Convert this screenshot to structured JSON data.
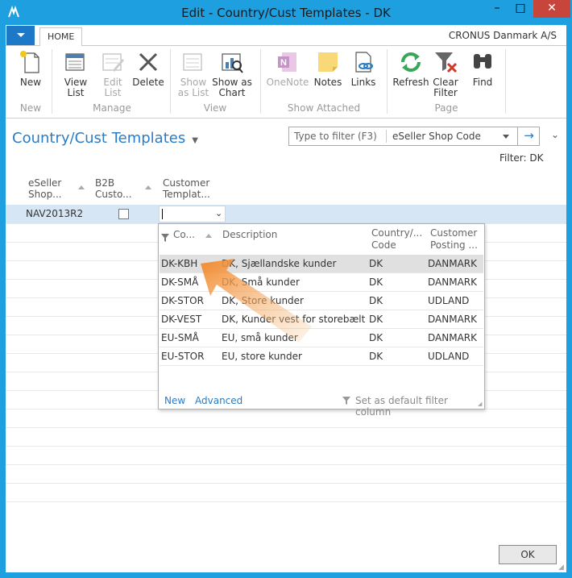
{
  "window": {
    "title": "Edit - Country/Cust Templates - DK",
    "minimize": "–",
    "maximize": "□",
    "close": "✕"
  },
  "ribbon": {
    "tab_home": "HOME",
    "company": "CRONUS Danmark A/S",
    "buttons": {
      "new": "New",
      "view_list_1": "View",
      "view_list_2": "List",
      "edit_list_1": "Edit",
      "edit_list_2": "List",
      "delete": "Delete",
      "show_as_list_1": "Show",
      "show_as_list_2": "as List",
      "show_as_chart_1": "Show as",
      "show_as_chart_2": "Chart",
      "onenote": "OneNote",
      "notes": "Notes",
      "links": "Links",
      "refresh": "Refresh",
      "clear_filter_1": "Clear",
      "clear_filter_2": "Filter",
      "find": "Find"
    },
    "groups": {
      "new": "New",
      "manage": "Manage",
      "view": "View",
      "show_attached": "Show Attached",
      "page": "Page"
    }
  },
  "page": {
    "title": "Country/Cust Templates",
    "filter_placeholder": "Type to filter (F3)",
    "filter_field": "eSeller Shop Code",
    "filter_info": "Filter: DK"
  },
  "grid": {
    "columns": [
      {
        "line1": "eSeller",
        "line2": "Shop..."
      },
      {
        "line1": "B2B",
        "line2": "Custo..."
      },
      {
        "line1": "Customer",
        "line2": "Templat..."
      }
    ],
    "row": {
      "shop": "NAV2013R2"
    }
  },
  "dropdown": {
    "headers": {
      "code": "Co...",
      "description": "Description",
      "country_1": "Country/...",
      "country_2": "Code",
      "posting_1": "Customer",
      "posting_2": "Posting ..."
    },
    "rows": [
      {
        "code": "DK-KBH",
        "description": "DK, Sjællandske kunder",
        "country": "DK",
        "posting": "DANMARK"
      },
      {
        "code": "DK-SMÅ",
        "description": "DK, Små kunder",
        "country": "DK",
        "posting": "DANMARK"
      },
      {
        "code": "DK-STOR",
        "description": "DK, Store kunder",
        "country": "DK",
        "posting": "UDLAND"
      },
      {
        "code": "DK-VEST",
        "description": "DK, Kunder vest for storebælt",
        "country": "DK",
        "posting": "DANMARK"
      },
      {
        "code": "EU-SMÅ",
        "description": "EU, små kunder",
        "country": "DK",
        "posting": "DANMARK"
      },
      {
        "code": "EU-STOR",
        "description": "EU, store kunder",
        "country": "DK",
        "posting": "UDLAND"
      }
    ],
    "footer": {
      "new": "New",
      "advanced": "Advanced",
      "set_default": "Set as default filter column"
    }
  },
  "buttons": {
    "ok": "OK"
  },
  "colors": {
    "titlebar": "#1e9fe0",
    "accent": "#2b7cc4",
    "close": "#c7453b",
    "arrow": "#f28a2e",
    "selected_row": "#d6e6f5"
  }
}
